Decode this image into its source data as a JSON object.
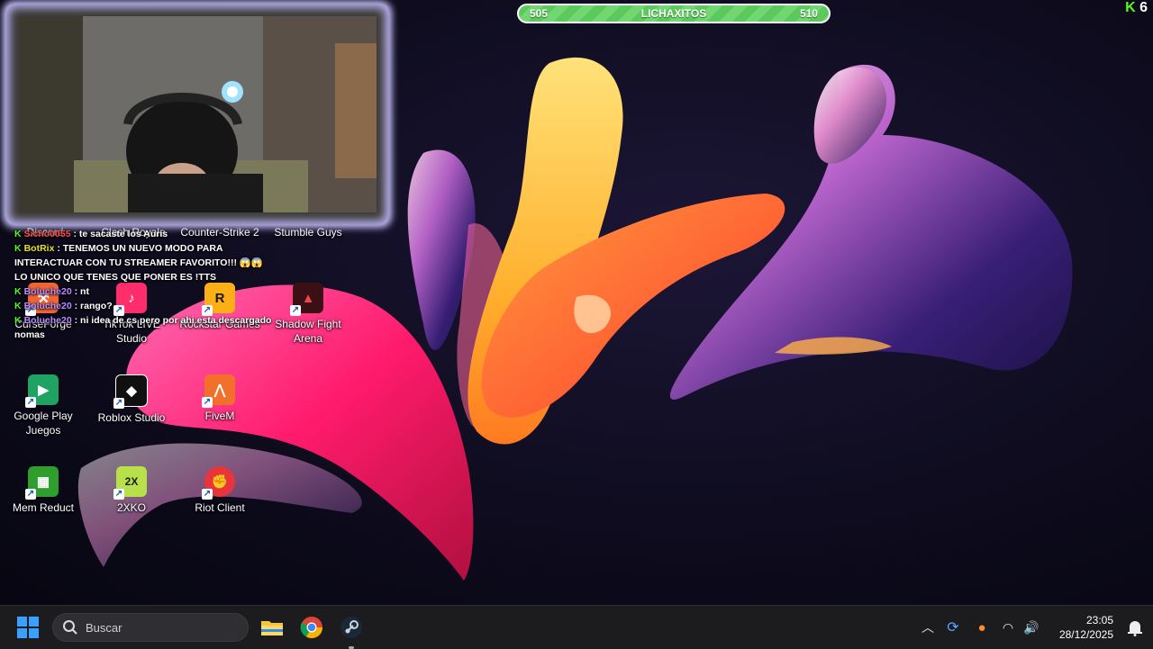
{
  "overlay": {
    "goal_bar": {
      "left_value": "505",
      "label": "LICHAXITOS",
      "right_value": "510"
    },
    "kick_count": "6"
  },
  "chat": {
    "messages": [
      {
        "user": "Sicho0055",
        "text": ": te sacaste los Auris",
        "user_style": "red"
      },
      {
        "user": "BotRix",
        "text": ": TENEMOS UN NUEVO MODO PARA INTERACTUAR CON TU STREAMER FAVORITO!!! 😱😱 LO UNICO QUE TENES QUE PONER ES !TTS",
        "user_style": "bot"
      },
      {
        "user": "Boluche20",
        "text": ": nt",
        "user_style": "user"
      },
      {
        "user": "Boluche20",
        "text": ": rango?",
        "user_style": "user"
      },
      {
        "user": "Boluche20",
        "text": ": ni idea de cs pero por ahi esta descargado nomas",
        "user_style": "user"
      }
    ]
  },
  "desktop_icons": [
    {
      "label": "Discord",
      "icon": "discord-icon",
      "color": "#5865f2"
    },
    {
      "label": "Clash Royale",
      "icon": "clash-royale-icon",
      "color": "#2a66c9"
    },
    {
      "label": "Counter-Strike 2",
      "icon": "counter-strike-icon",
      "color": "#c08a2a"
    },
    {
      "label": "Stumble Guys",
      "icon": "stumble-guys-icon",
      "color": "#f2b21c"
    },
    {
      "label": "CurseForge",
      "icon": "curseforge-icon",
      "color": "#f16436"
    },
    {
      "label": "TikTok LIVE Studio",
      "icon": "tiktok-icon",
      "color": "#ff2d6a"
    },
    {
      "label": "Rockstar Games",
      "icon": "rockstar-icon",
      "color": "#fcaf17"
    },
    {
      "label": "Shadow Fight Arena",
      "icon": "shadow-fight-icon",
      "color": "#c0252b"
    },
    {
      "label": "Google Play Juegos",
      "icon": "google-play-games-icon",
      "color": "#1ea362"
    },
    {
      "label": "Roblox Studio",
      "icon": "roblox-studio-icon",
      "color": "#101010"
    },
    {
      "label": "FiveM",
      "icon": "fivem-icon",
      "color": "#f3702b"
    },
    {
      "label": "Mem Reduct",
      "icon": "mem-reduct-icon",
      "color": "#2f9e2f"
    },
    {
      "label": "2XKO",
      "icon": "2xko-icon",
      "color": "#b8e04a"
    },
    {
      "label": "Riot Client",
      "icon": "riot-client-icon",
      "color": "#e8353b"
    }
  ],
  "taskbar": {
    "search_placeholder": "Buscar",
    "time": "23:05",
    "date": "28/12/2025",
    "pinned": [
      "file-explorer-icon",
      "chrome-icon",
      "steam-icon"
    ],
    "tray": [
      "chevron-up-icon",
      "sync-icon",
      "microphone-icon",
      "wifi-icon",
      "volume-icon",
      "notifications-icon"
    ]
  }
}
